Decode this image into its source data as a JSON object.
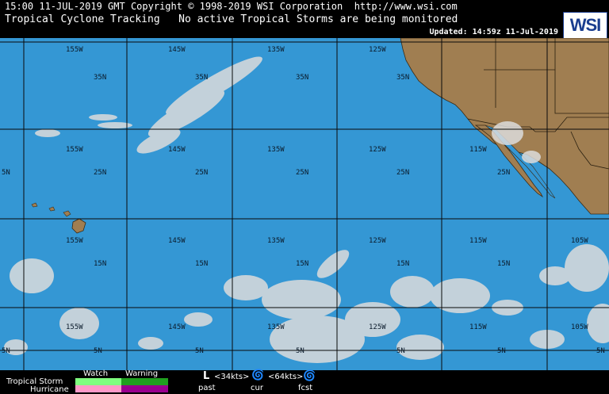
{
  "header": {
    "line1": "15:00 11-JUL-2019 GMT Copyright © 1998-2019 WSI Corporation  http://www.wsi.com",
    "line2": "Tropical Cyclone Tracking   No active Tropical Storms are being monitored",
    "updated": "Updated: 14:59z 11-Jul-2019",
    "logo": "WSI"
  },
  "map": {
    "colors": {
      "ocean": "#3497d4",
      "land": "#a07e51",
      "grid": "#0a0a0a",
      "cloud": "#d8d8d8"
    },
    "lon_labels_row1": [
      "155W",
      "145W",
      "135W",
      "125W"
    ],
    "lat_labels_row1": [
      "35N",
      "35N",
      "35N",
      "35N"
    ],
    "lon_labels_row2": [
      "155W",
      "145W",
      "135W",
      "125W",
      "115W"
    ],
    "lat_labels_row2": [
      "5N",
      "25N",
      "25N",
      "25N",
      "25N",
      "25N"
    ],
    "lon_labels_row3": [
      "155W",
      "145W",
      "135W",
      "125W",
      "115W",
      "105W"
    ],
    "lat_labels_row3": [
      "15N",
      "15N",
      "15N",
      "15N",
      "15N"
    ],
    "lon_labels_row4": [
      "155W",
      "145W",
      "135W",
      "125W",
      "115W",
      "105W"
    ],
    "lat_labels_row4": [
      "5N",
      "5N",
      "5N",
      "5N",
      "5N",
      "5N",
      "5N"
    ]
  },
  "legend": {
    "watch": "Watch",
    "warning": "Warning",
    "tropical_storm": "Tropical Storm",
    "hurricane": "Hurricane",
    "ts_speed": "<34kts>",
    "hu_speed": "<64kts>",
    "past": "past",
    "cur": "cur",
    "fcst": "fcst",
    "colors": {
      "ts_watch": "#7fff7f",
      "ts_warning": "#1fa01f",
      "hu_watch": "#ff99c8",
      "hu_warning": "#99008f"
    }
  }
}
